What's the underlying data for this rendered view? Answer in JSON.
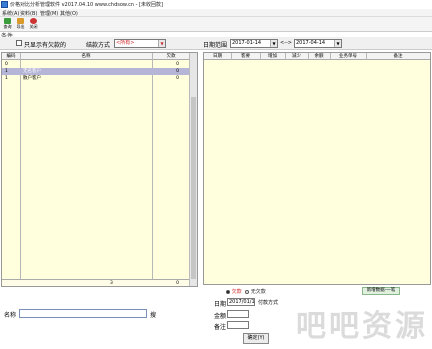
{
  "window": {
    "title": "价格对比分析管理软件 v2017.04.10 www.chdsow.cn - [未收回款]",
    "icon": "app-icon"
  },
  "menu": {
    "items": [
      "系统(A)",
      "资料(B)",
      "管理(M)",
      "其他(O)"
    ]
  },
  "toolbar": {
    "query_label": "查询",
    "export_label": "导出",
    "close_label": "关闭"
  },
  "conditions": {
    "section_label": "条件",
    "only_debt_label": "只显示有欠款的",
    "settle_label": "结款方式",
    "settle_value": "<所有>",
    "date_range_label": "日期范围",
    "date_from": "2017-01-14",
    "date_sep": "<-->",
    "date_to": "2017-04-14"
  },
  "left_table": {
    "columns": [
      "编码",
      "名称",
      "欠款"
    ],
    "rows": [
      {
        "code": "0",
        "name": "",
        "debt": "0"
      },
      {
        "code": "1",
        "name": "无名客户",
        "debt": "0"
      },
      {
        "code": "1",
        "name": "散户客户",
        "debt": "0"
      }
    ],
    "footer_count": "3",
    "footer_total": "0"
  },
  "right_table": {
    "columns": [
      "日期",
      "客要",
      "增加",
      "减少",
      "余额",
      "业务单号",
      "备注"
    ]
  },
  "bottom": {
    "radio_debt_label": "欠款",
    "radio_nodebt_label": "无欠款",
    "new_btn_label": "新增数据-一笔",
    "name_label": "名称",
    "search_label": "搜",
    "date_label": "日期",
    "date_value": "2017/01/1",
    "pay_label": "付款方式",
    "amount_label": "金额",
    "remark_label": "备注",
    "ok_label": "确定(Y)"
  },
  "watermark": "吧吧资源",
  "colors": {
    "panel_bg": "#ffffdd",
    "selected_row": "#b5b5d8",
    "accent_red": "#cc2222"
  }
}
